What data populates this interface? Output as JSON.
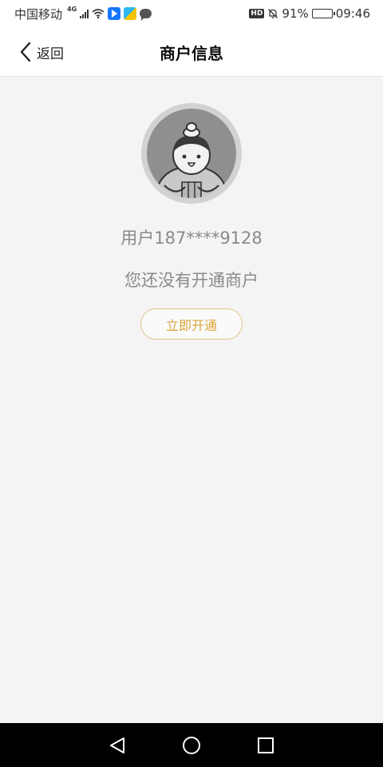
{
  "status_bar": {
    "carrier": "中国移动",
    "network": "4G",
    "hd_badge": "HD",
    "battery_percent": "91%",
    "battery_level": 0.91,
    "time": "09:46",
    "icons": [
      "signal-icon",
      "wifi-icon",
      "app-notification-icon",
      "app-notification-icon",
      "chat-icon",
      "hd-icon",
      "bell-off-icon",
      "battery-icon"
    ]
  },
  "header": {
    "back_label": "返回",
    "title": "商户信息"
  },
  "main": {
    "username": "用户187****9128",
    "notice": "您还没有开通商户",
    "open_button_label": "立即开通"
  },
  "nav": {
    "icons": [
      "back-triangle-icon",
      "home-circle-icon",
      "recents-square-icon"
    ]
  },
  "colors": {
    "background": "#f4f4f4",
    "accent": "#d9a53a",
    "accent_border": "#e2c48b",
    "secondary_text": "#8a8a8a"
  }
}
